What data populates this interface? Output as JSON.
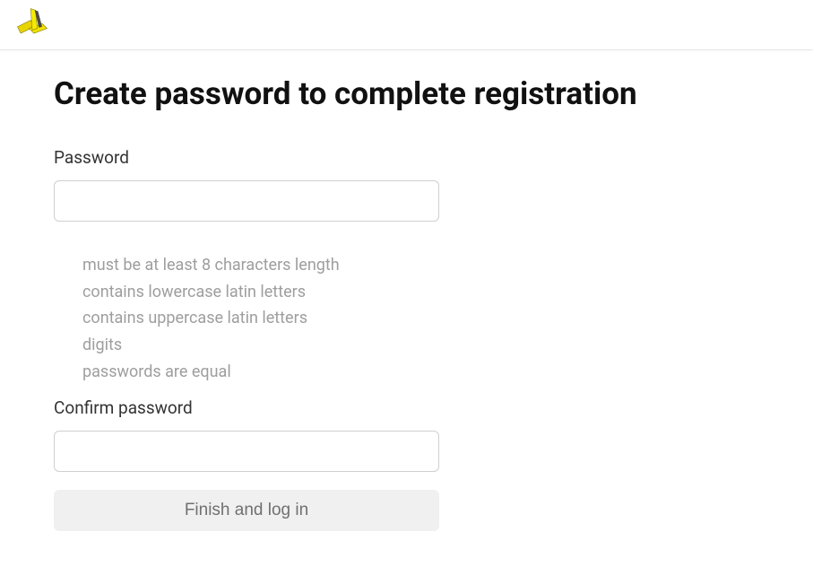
{
  "header": {
    "logo_alt": "logo"
  },
  "page": {
    "title": "Create password to complete registration"
  },
  "form": {
    "password_label": "Password",
    "password_value": "",
    "confirm_label": "Confirm password",
    "confirm_value": "",
    "submit_label": "Finish and log in"
  },
  "rules": {
    "min_length": "must be at least 8 characters length",
    "lowercase": "contains lowercase latin letters",
    "uppercase": "contains uppercase latin letters",
    "digits": "digits",
    "match": "passwords are equal"
  }
}
